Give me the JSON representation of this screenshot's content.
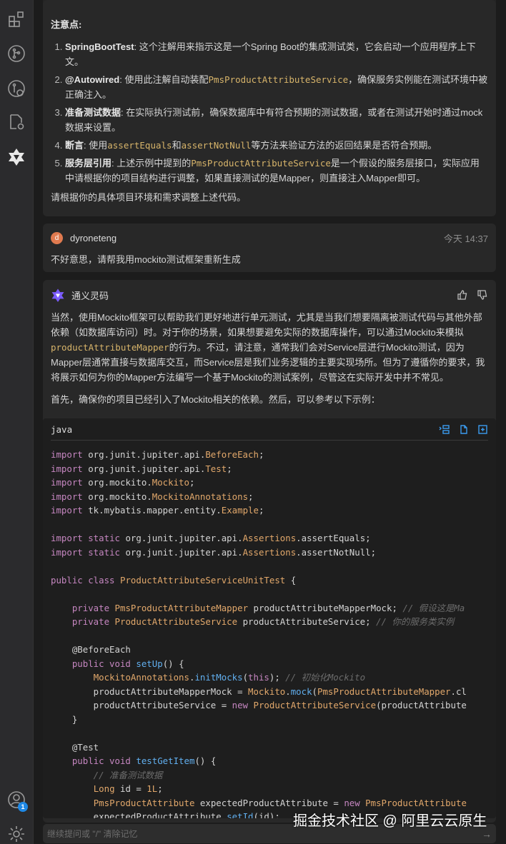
{
  "sidebar": {
    "icons": [
      "extensions-icon",
      "source-control-icon",
      "git-graph-icon",
      "settings-file-icon",
      "tongyi-lingma-icon"
    ],
    "account_badge": "1"
  },
  "previous_answer": {
    "heading": "注意点:",
    "items": [
      {
        "num": "1.",
        "bold": "SpringBootTest",
        "pre": ": 这个注解用来指示这是一个Spring Boot的集成测试类，它会启动一个应用程序上下文。",
        "code": "",
        "post": ""
      },
      {
        "num": "2.",
        "bold": "@Autowired",
        "pre": ": 使用此注解自动装配",
        "code": "PmsProductAttributeService",
        "post": "，确保服务实例能在测试环境中被正确注入。"
      },
      {
        "num": "3.",
        "bold": "准备测试数据",
        "pre": ": 在实际执行测试前，确保数据库中有符合预期的测试数据，或者在测试开始时通过mock数据来设置。",
        "code": "",
        "post": ""
      },
      {
        "num": "4.",
        "bold": "断言",
        "pre": ": 使用",
        "code": "assertEquals",
        "post": "和",
        "code2": "assertNotNull",
        "post2": "等方法来验证方法的返回结果是否符合预期。"
      },
      {
        "num": "5.",
        "bold": "服务层引用",
        "pre": ": 上述示例中提到的",
        "code": "PmsProductAttributeService",
        "post": "是一个假设的服务层接口，实际应用中请根据你的项目结构进行调整，如果直接测试的是Mapper，则直接注入Mapper即可。"
      }
    ],
    "closing": "请根据你的具体项目环境和需求调整上述代码。"
  },
  "user_message": {
    "avatar_letter": "d",
    "username": "dyroneteng",
    "time": "今天 14:37",
    "text": "不好意思，请帮我用mockito测试框架重新生成"
  },
  "bot_message": {
    "name": "通义灵码",
    "p1_a": "当然，使用Mockito框架可以帮助我们更好地进行单元测试，尤其是当我们想要隔离被测试代码与其他外部依赖（如数据库访问）时。对于你的场景，如果想要避免实际的数据库操作，可以通过Mockito来模拟",
    "p1_code": "productAttributeMapper",
    "p1_b": "的行为。不过，请注意，通常我们会对Service层进行Mockito测试，因为Mapper层通常直接与数据库交互，而Service层是我们业务逻辑的主要实现场所。但为了遵循你的要求，我将展示如何为你的Mapper方法编写一个基于Mockito的测试案例，尽管这在实际开发中并不常见。",
    "p2": "首先，确保你的项目已经引入了Mockito相关的依赖。然后，可以参考以下示例：",
    "code_lang": "java",
    "code_lines": [
      [
        [
          "import",
          "k"
        ],
        [
          " org.junit.jupiter.api.",
          "p"
        ],
        [
          "BeforeEach",
          "c"
        ],
        [
          ";",
          "p"
        ]
      ],
      [
        [
          "import",
          "k"
        ],
        [
          " org.junit.jupiter.api.",
          "p"
        ],
        [
          "Test",
          "c"
        ],
        [
          ";",
          "p"
        ]
      ],
      [
        [
          "import",
          "k"
        ],
        [
          " org.mockito.",
          "p"
        ],
        [
          "Mockito",
          "c"
        ],
        [
          ";",
          "p"
        ]
      ],
      [
        [
          "import",
          "k"
        ],
        [
          " org.mockito.",
          "p"
        ],
        [
          "MockitoAnnotations",
          "c"
        ],
        [
          ";",
          "p"
        ]
      ],
      [
        [
          "import",
          "k"
        ],
        [
          " tk.mybatis.mapper.entity.",
          "p"
        ],
        [
          "Example",
          "c"
        ],
        [
          ";",
          "p"
        ]
      ],
      [],
      [
        [
          "import",
          "k"
        ],
        [
          " static",
          "k"
        ],
        [
          " org.junit.jupiter.api.",
          "p"
        ],
        [
          "Assertions",
          "c"
        ],
        [
          ".assertEquals;",
          "p"
        ]
      ],
      [
        [
          "import",
          "k"
        ],
        [
          " static",
          "k"
        ],
        [
          " org.junit.jupiter.api.",
          "p"
        ],
        [
          "Assertions",
          "c"
        ],
        [
          ".assertNotNull;",
          "p"
        ]
      ],
      [],
      [
        [
          "public class",
          "k"
        ],
        [
          " ",
          "p"
        ],
        [
          "ProductAttributeServiceUnitTest",
          "c"
        ],
        [
          " {",
          "p"
        ]
      ],
      [],
      [
        [
          "    private",
          "k"
        ],
        [
          " ",
          "p"
        ],
        [
          "PmsProductAttributeMapper",
          "c"
        ],
        [
          " productAttributeMapperMock; ",
          "p"
        ],
        [
          "// 假设这是Ma",
          "cm"
        ]
      ],
      [
        [
          "    private",
          "k"
        ],
        [
          " ",
          "p"
        ],
        [
          "ProductAttributeService",
          "c"
        ],
        [
          " productAttributeService; ",
          "p"
        ],
        [
          "// 你的服务类实例",
          "cm"
        ]
      ],
      [],
      [
        [
          "    @BeforeEach",
          "p"
        ]
      ],
      [
        [
          "    public void",
          "k"
        ],
        [
          " ",
          "p"
        ],
        [
          "setUp",
          "m"
        ],
        [
          "() {",
          "p"
        ]
      ],
      [
        [
          "        ",
          "p"
        ],
        [
          "MockitoAnnotations",
          "c"
        ],
        [
          ".",
          "p"
        ],
        [
          "initMocks",
          "m"
        ],
        [
          "(",
          "p"
        ],
        [
          "this",
          "k"
        ],
        [
          "); ",
          "p"
        ],
        [
          "// 初始化Mockito",
          "cm"
        ]
      ],
      [
        [
          "        productAttributeMapperMock = ",
          "p"
        ],
        [
          "Mockito",
          "c"
        ],
        [
          ".",
          "p"
        ],
        [
          "mock",
          "m"
        ],
        [
          "(",
          "p"
        ],
        [
          "PmsProductAttributeMapper",
          "c"
        ],
        [
          ".cl",
          "p"
        ]
      ],
      [
        [
          "        productAttributeService = ",
          "p"
        ],
        [
          "new",
          "k"
        ],
        [
          " ",
          "p"
        ],
        [
          "ProductAttributeService",
          "c"
        ],
        [
          "(productAttribute",
          "p"
        ]
      ],
      [
        [
          "    }",
          "p"
        ]
      ],
      [],
      [
        [
          "    @Test",
          "p"
        ]
      ],
      [
        [
          "    public void",
          "k"
        ],
        [
          " ",
          "p"
        ],
        [
          "testGetItem",
          "m"
        ],
        [
          "() {",
          "p"
        ]
      ],
      [
        [
          "        // 准备测试数据",
          "cm"
        ]
      ],
      [
        [
          "        ",
          "p"
        ],
        [
          "Long",
          "c"
        ],
        [
          " id = ",
          "p"
        ],
        [
          "1L",
          "c"
        ],
        [
          ";",
          "p"
        ]
      ],
      [
        [
          "        ",
          "p"
        ],
        [
          "PmsProductAttribute",
          "c"
        ],
        [
          " expectedProductAttribute = ",
          "p"
        ],
        [
          "new",
          "k"
        ],
        [
          " ",
          "p"
        ],
        [
          "PmsProductAttribute",
          "c"
        ]
      ],
      [
        [
          "        expectedProductAttribute.",
          "p"
        ],
        [
          "setId",
          "m"
        ],
        [
          "(id);",
          "p"
        ]
      ]
    ]
  },
  "input": {
    "placeholder": "继续提问或 \"/\" 清除记忆"
  },
  "watermark": "掘金技术社区 @ 阿里云云原生"
}
